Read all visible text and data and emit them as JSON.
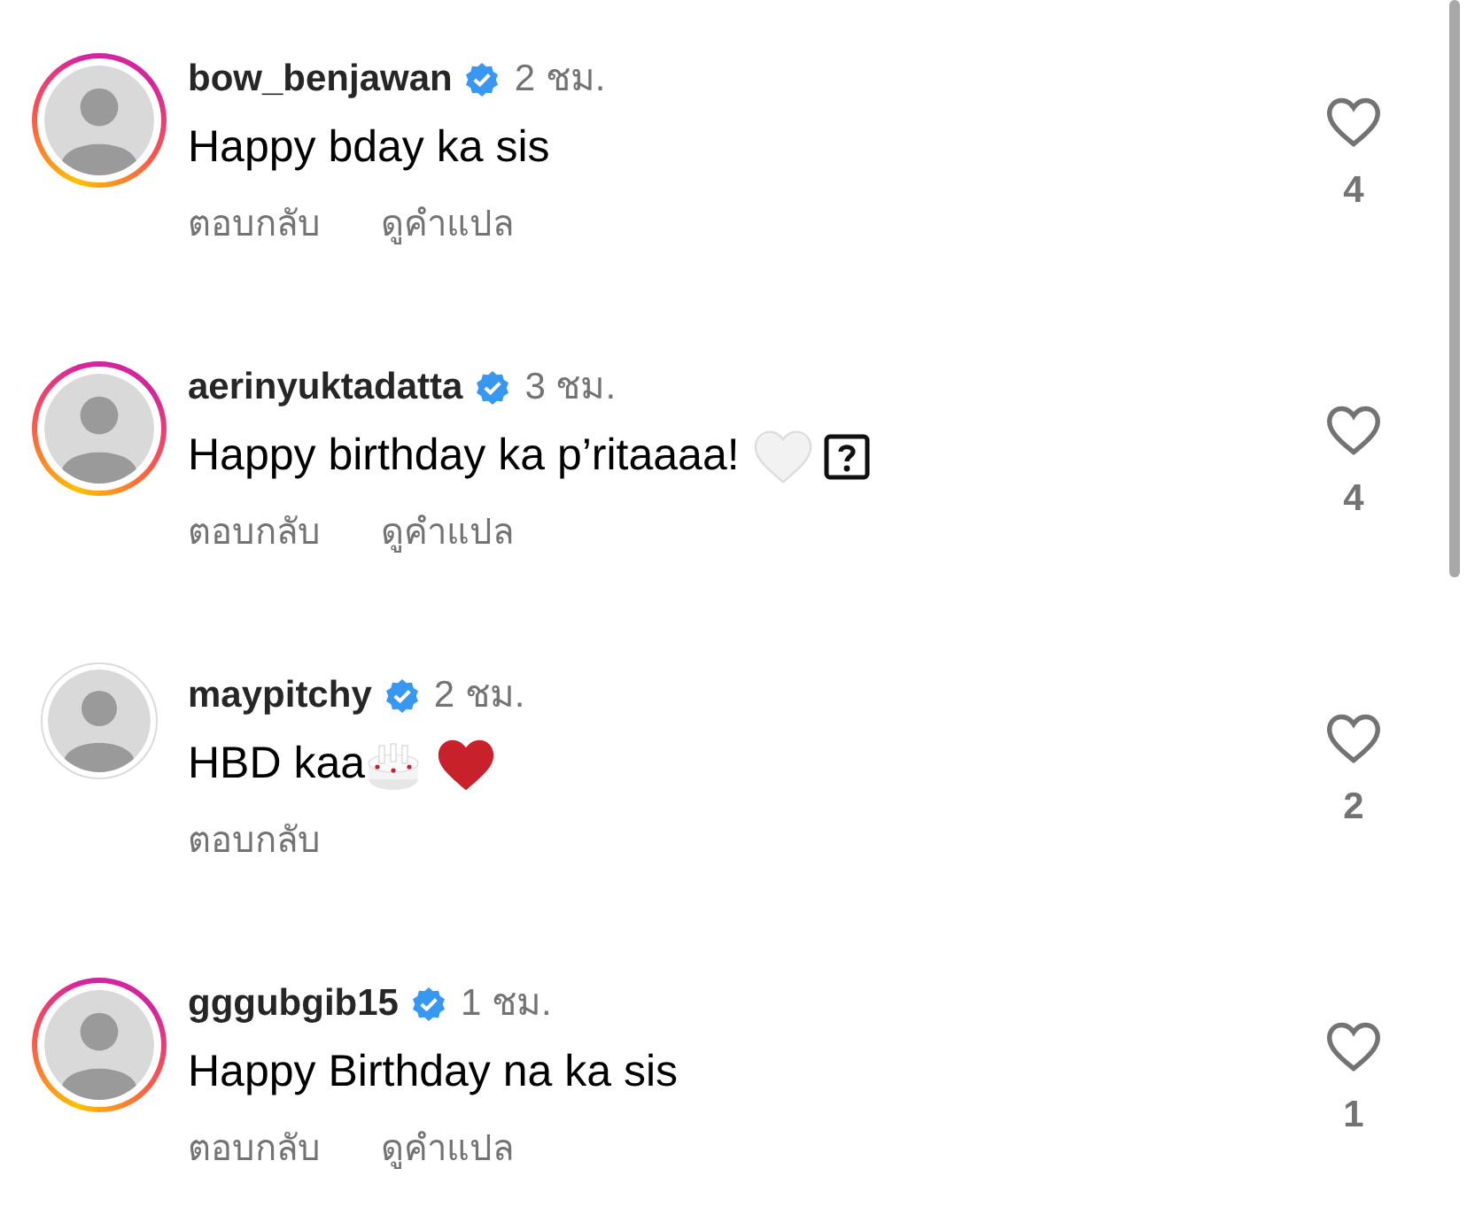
{
  "comments": [
    {
      "username": "bow_benjawan",
      "verified": true,
      "time": "2 ชม.",
      "story_ring": true,
      "text": "Happy bday ka sis",
      "actions": [
        "ตอบกลับ",
        "ดูคำแปล"
      ],
      "likes": "4"
    },
    {
      "username": "aerinyuktadatta",
      "verified": true,
      "time": "3 ชม.",
      "story_ring": true,
      "text": "Happy birthday ka p’ritaaaa!",
      "emojis": [
        {
          "kind": "white_heart"
        },
        {
          "kind": "missing_glyph"
        }
      ],
      "actions": [
        "ตอบกลับ",
        "ดูคำแปล"
      ],
      "likes": "4"
    },
    {
      "username": "maypitchy",
      "verified": true,
      "time": "2 ชม.",
      "story_ring": false,
      "text": "HBD kaa",
      "emojis": [
        {
          "kind": "cake"
        },
        {
          "kind": "red_heart"
        }
      ],
      "actions": [
        "ตอบกลับ"
      ],
      "likes": "2"
    },
    {
      "username": "gggubgib15",
      "verified": true,
      "time": "1 ชม.",
      "story_ring": true,
      "text": "Happy Birthday na ka sis",
      "actions": [
        "ตอบกลับ",
        "ดูคำแปล"
      ],
      "likes": "1"
    }
  ]
}
